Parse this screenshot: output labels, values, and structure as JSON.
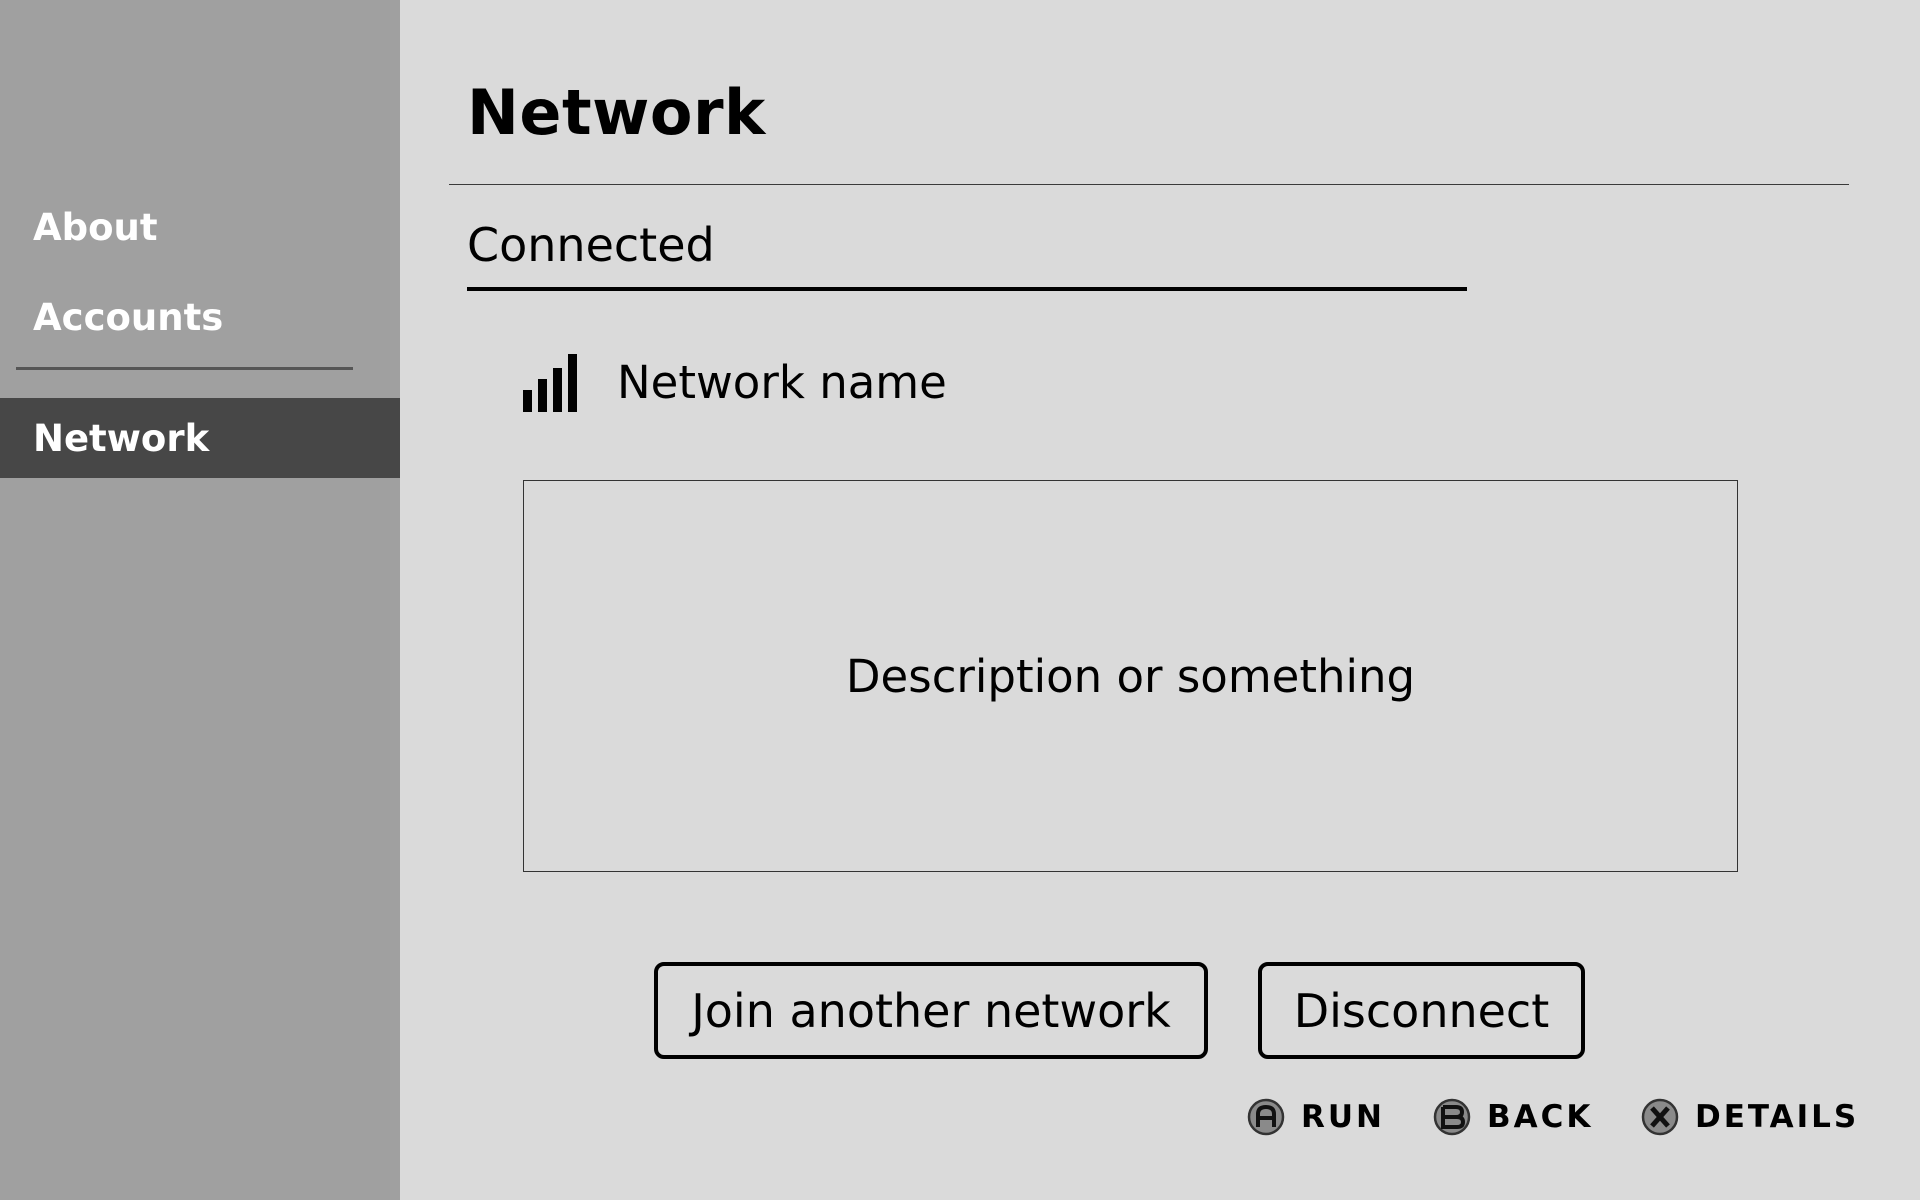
{
  "sidebar": {
    "items": [
      {
        "label": "About",
        "selected": false
      },
      {
        "label": "Accounts",
        "selected": false
      },
      {
        "label": "Network",
        "selected": true
      }
    ]
  },
  "main": {
    "title": "Network",
    "section_label": "Connected",
    "network": {
      "name": "Network name",
      "signal_icon": "signal-bars-icon",
      "signal_level": "4/4"
    },
    "description": "Description or something",
    "buttons": {
      "join": "Join another network",
      "disconnect": "Disconnect"
    }
  },
  "footer": {
    "hints": [
      {
        "glyph": "A",
        "label": "RUN"
      },
      {
        "glyph": "B",
        "label": "BACK"
      },
      {
        "glyph": "X",
        "label": "DETAILS"
      }
    ]
  },
  "colors": {
    "background": "#dadada",
    "sidebar": "#a0a0a0",
    "sidebar_selected": "#474747",
    "sidebar_text": "#ffffff",
    "text": "#000000"
  }
}
